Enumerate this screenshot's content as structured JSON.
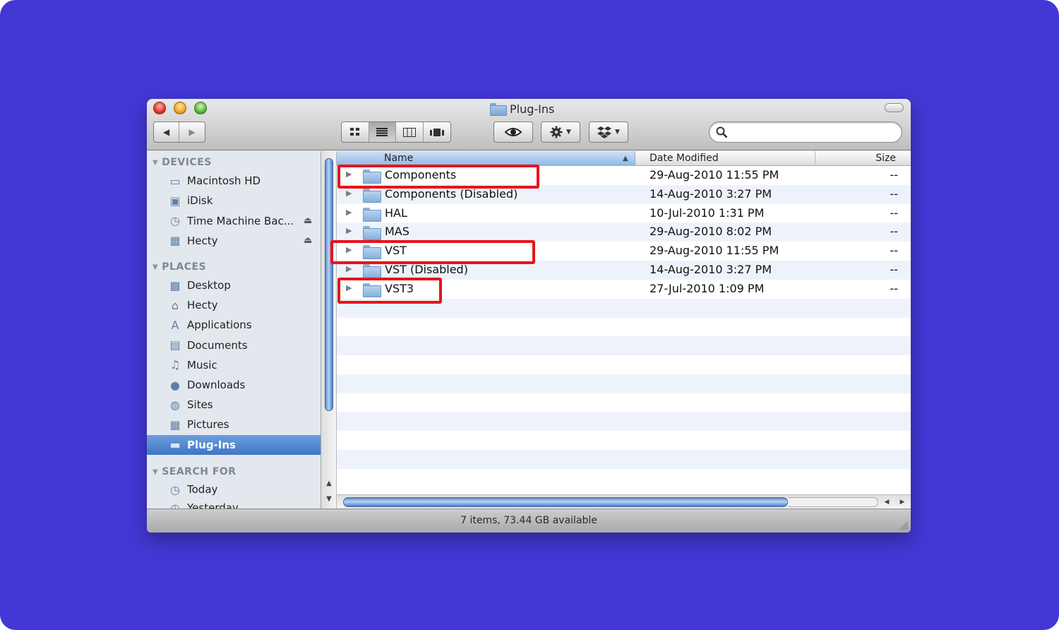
{
  "window": {
    "title": "Plug-Ins"
  },
  "toolbar": {
    "back_icon": "◀",
    "forward_icon": "▶",
    "views": [
      "icon-view",
      "list-view",
      "column-view",
      "coverflow-view"
    ],
    "quicklook_icon": "eye-icon",
    "action_icon": "gear-icon",
    "dropbox_icon": "dropbox-icon",
    "search_placeholder": ""
  },
  "sidebar": {
    "devices_header": "DEVICES",
    "devices": [
      {
        "label": "Macintosh HD",
        "icon": "hard-drive-icon",
        "glyph": "▭"
      },
      {
        "label": "iDisk",
        "icon": "idisk-icon",
        "glyph": "▣"
      },
      {
        "label": "Time Machine Bac...",
        "icon": "time-machine-icon",
        "glyph": "◷"
      },
      {
        "label": "Hecty",
        "icon": "external-drive-icon",
        "glyph": "▦"
      }
    ],
    "eject_glyph": "⏏",
    "places_header": "PLACES",
    "places": [
      {
        "label": "Desktop",
        "icon": "desktop-icon",
        "glyph": "▩"
      },
      {
        "label": "Hecty",
        "icon": "home-icon",
        "glyph": "⌂"
      },
      {
        "label": "Applications",
        "icon": "applications-icon",
        "glyph": "A"
      },
      {
        "label": "Documents",
        "icon": "documents-icon",
        "glyph": "▤"
      },
      {
        "label": "Music",
        "icon": "music-icon",
        "glyph": "♫"
      },
      {
        "label": "Downloads",
        "icon": "downloads-icon",
        "glyph": "●"
      },
      {
        "label": "Sites",
        "icon": "sites-icon",
        "glyph": "◍"
      },
      {
        "label": "Pictures",
        "icon": "pictures-icon",
        "glyph": "▦"
      },
      {
        "label": "Plug-Ins",
        "icon": "folder-icon",
        "glyph": "▬",
        "selected": true
      }
    ],
    "search_header": "SEARCH FOR",
    "search_items": [
      {
        "label": "Today",
        "icon": "clock-icon",
        "glyph": "◷"
      },
      {
        "label": "Yesterday",
        "icon": "clock-icon",
        "glyph": "◷"
      }
    ]
  },
  "list": {
    "columns": {
      "name": "Name",
      "date": "Date Modified",
      "size": "Size",
      "sort_indicator": "▲"
    },
    "rows": [
      {
        "name": "Components",
        "date": "29-Aug-2010 11:55 PM",
        "size": "--"
      },
      {
        "name": "Components (Disabled)",
        "date": "14-Aug-2010 3:27 PM",
        "size": "--"
      },
      {
        "name": "HAL",
        "date": "10-Jul-2010 1:31 PM",
        "size": "--"
      },
      {
        "name": "MAS",
        "date": "29-Aug-2010 8:02 PM",
        "size": "--"
      },
      {
        "name": "VST",
        "date": "29-Aug-2010 11:55 PM",
        "size": "--"
      },
      {
        "name": "VST (Disabled)",
        "date": "14-Aug-2010 3:27 PM",
        "size": "--"
      },
      {
        "name": "VST3",
        "date": "27-Jul-2010 1:09 PM",
        "size": "--"
      }
    ],
    "disclosure_glyph": "▶"
  },
  "status": {
    "text": "7 items, 73.44 GB available"
  },
  "colors": {
    "background": "#4338d6",
    "highlight": "#e8141b",
    "selection": "#3e76c7"
  }
}
